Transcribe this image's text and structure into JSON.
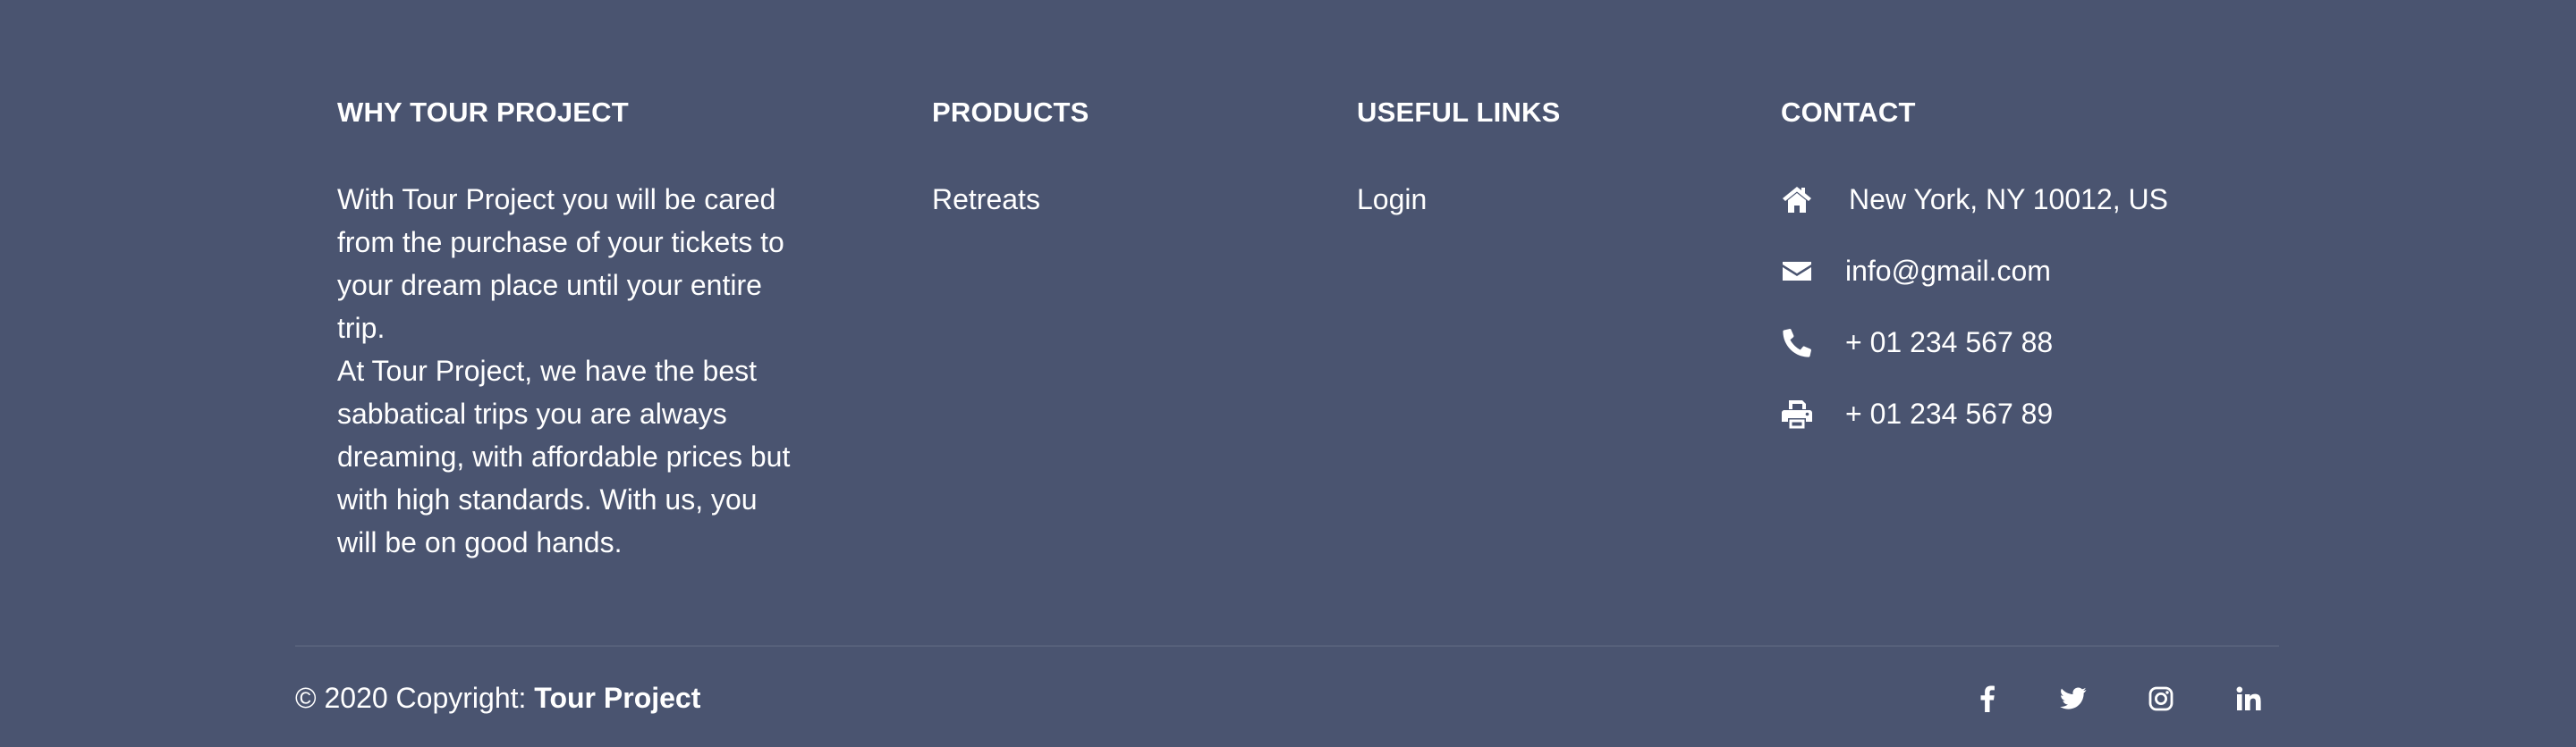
{
  "why": {
    "heading": "WHY TOUR PROJECT",
    "paragraph_1": "With Tour Project you will be cared from the purchase of your tickets to your dream place until your entire trip.",
    "paragraph_2": "At Tour Project, we have the best sabbatical trips you are always dreaming, with affordable prices but with high standards. With us, you will be on good hands."
  },
  "products": {
    "heading": "PRODUCTS",
    "items": [
      {
        "label": "Retreats"
      }
    ]
  },
  "useful_links": {
    "heading": "USEFUL LINKS",
    "items": [
      {
        "label": "Login"
      }
    ]
  },
  "contact": {
    "heading": "CONTACT",
    "items": [
      {
        "icon": "home-icon",
        "text": "New York, NY 10012, US"
      },
      {
        "icon": "envelope-icon",
        "text": "info@gmail.com"
      },
      {
        "icon": "phone-icon",
        "text": "+ 01 234 567 88"
      },
      {
        "icon": "print-icon",
        "text": "+ 01 234 567 89"
      }
    ]
  },
  "footer_bottom": {
    "copyright_prefix": "© 2020 Copyright:",
    "copyright_brand": "Tour Project",
    "social": [
      {
        "icon": "facebook-icon"
      },
      {
        "icon": "twitter-icon"
      },
      {
        "icon": "instagram-icon"
      },
      {
        "icon": "linkedin-icon"
      }
    ]
  },
  "colors": {
    "background": "#4a5470",
    "text": "#ffffff"
  }
}
